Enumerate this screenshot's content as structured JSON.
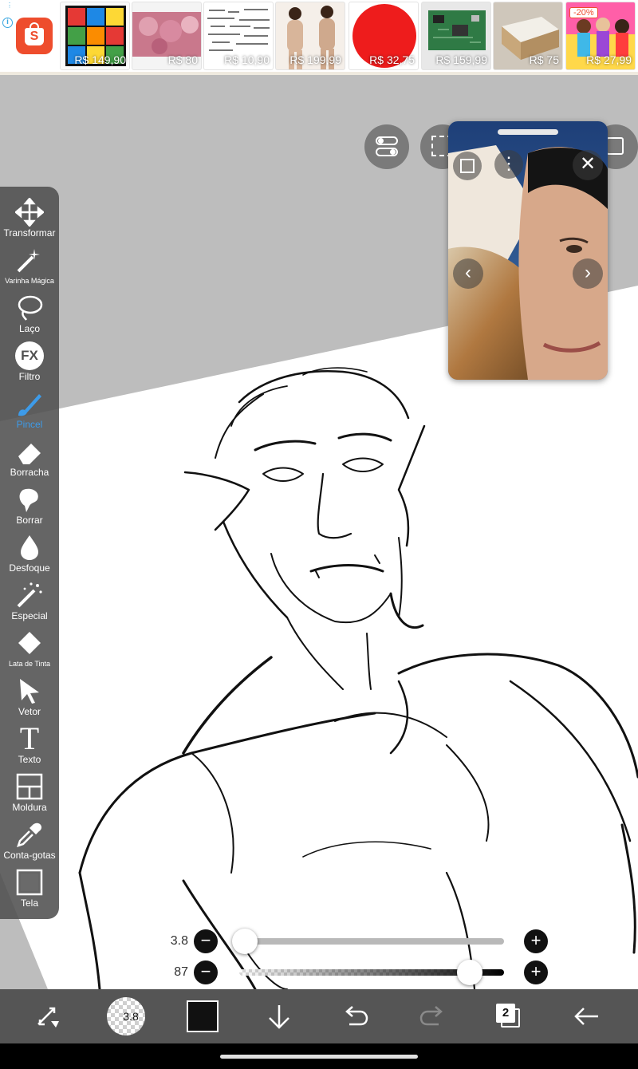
{
  "ad_banner": {
    "info_icon": "info-icon",
    "brand_icon": "shopee-bag-icon",
    "brand_letter": "S",
    "products": [
      {
        "price": "R$ 149,90",
        "image": "rubiks-cube"
      },
      {
        "price": "R$ 80",
        "image": "pink-texture"
      },
      {
        "price": "R$ 10,90",
        "image": "pattern-sheet"
      },
      {
        "price": "R$ 199,99",
        "image": "beige-outfit"
      },
      {
        "price": "R$ 32,75",
        "image": "red-ball"
      },
      {
        "price": "R$ 159,99",
        "image": "circuit-board"
      },
      {
        "price": "R$ 75",
        "image": "box-package"
      },
      {
        "price": "R$ 27,99",
        "image": "colorful-kids",
        "discount": "-20%"
      }
    ]
  },
  "canvas": {
    "top_buttons": [
      {
        "icon": "toggle-icon"
      },
      {
        "icon": "selection-icon"
      },
      {
        "icon": "layer-square-icon"
      }
    ]
  },
  "video_popup": {
    "icons": [
      "pip-square-icon",
      "more-vertical-icon",
      "close-icon",
      "chevron-left-icon",
      "chevron-right-icon"
    ]
  },
  "tools": [
    {
      "label": "Transformar",
      "icon": "move-arrows-icon"
    },
    {
      "label": "Varinha Mágica",
      "icon": "magic-wand-icon"
    },
    {
      "label": "Laço",
      "icon": "lasso-icon"
    },
    {
      "label": "Filtro",
      "icon": "fx-filter-icon",
      "icon_text": "FX"
    },
    {
      "label": "Pincel",
      "icon": "brush-icon",
      "active": true
    },
    {
      "label": "Borracha",
      "icon": "eraser-icon"
    },
    {
      "label": "Borrar",
      "icon": "smudge-icon"
    },
    {
      "label": "Desfoque",
      "icon": "blur-drop-icon"
    },
    {
      "label": "Especial",
      "icon": "special-wand-icon"
    },
    {
      "label": "Lata de Tinta",
      "icon": "paint-bucket-icon"
    },
    {
      "label": "Vetor",
      "icon": "cursor-arrow-icon"
    },
    {
      "label": "Texto",
      "icon": "text-icon",
      "icon_text": "T"
    },
    {
      "label": "Moldura",
      "icon": "frame-icon"
    },
    {
      "label": "Conta-gotas",
      "icon": "eyedropper-icon"
    },
    {
      "label": "Tela",
      "icon": "canvas-icon"
    }
  ],
  "brush_size": {
    "value": "3.8",
    "fraction": 0.02
  },
  "opacity": {
    "value": "87",
    "fraction": 0.87
  },
  "bottom_bar": {
    "brush_preview_value": "3.8",
    "color": "#111111",
    "layers_count": "2",
    "icons": [
      "swap-icon",
      "brush-preview-icon",
      "color-swatch-icon",
      "download-arrow-icon",
      "undo-icon",
      "redo-icon",
      "layers-icon",
      "back-arrow-icon"
    ]
  },
  "colors": {
    "active_tool": "#3d9be9",
    "toolbar": "#505050",
    "canvas_bg": "#bdbdbd",
    "shopee": "#ee4d2d"
  }
}
